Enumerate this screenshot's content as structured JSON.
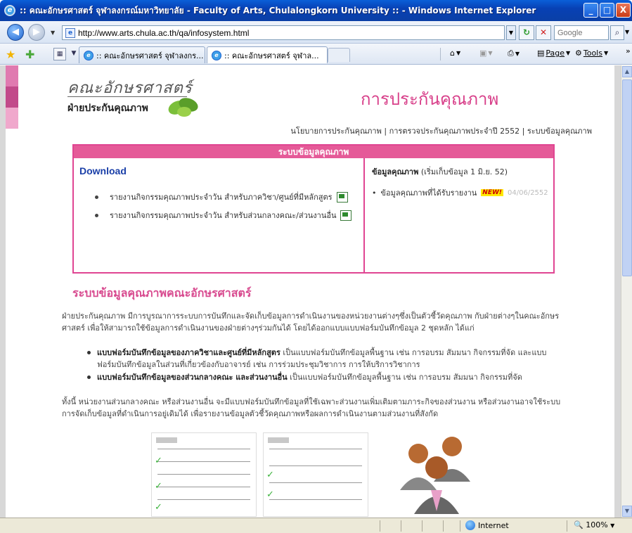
{
  "window": {
    "title": ":: คณะอักษรศาสตร์ จุฬาลงกรณ์มหาวิทยาลัย - Faculty of Arts, Chulalongkorn University :: - Windows Internet Explorer",
    "minimize": "_",
    "maximize": "□",
    "close": "X"
  },
  "addressbar": {
    "url": "http://www.arts.chula.ac.th/qa/infosystem.html",
    "search_placeholder": "Google"
  },
  "tabs": [
    {
      "label": ":: คณะอักษรศาสตร์ จุฬาลงกร..."
    },
    {
      "label": ":: คณะอักษรศาสตร์ จุฬาล...",
      "close": "X"
    }
  ],
  "commandbar": {
    "page": "Page",
    "tools": "Tools",
    "more": "»"
  },
  "site": {
    "logo_line1": "คณะอักษรศาสตร์",
    "logo_line2": "ฝ่ายประกันคุณภาพ",
    "page_heading": "การประกันคุณภาพ",
    "topnav": [
      "นโยบายการประกันคุณภาพ",
      "การตรวจประกันคุณภาพประจำปี 2552",
      "ระบบข้อมูลคุณภาพ"
    ],
    "topnav_separator": "|"
  },
  "infobox": {
    "header": "ระบบข้อมูลคุณภาพ",
    "download_title": "Download",
    "download_items": [
      "รายงานกิจกรรมคุณภาพประจำวัน สำหรับภาควิชา/ศูนย์ที่มีหลักสูตร",
      "รายงานกิจกรรมคุณภาพประจำวัน สำหรับส่วนกลางคณะ/ส่วนงานอื่น"
    ],
    "right_title_bold": "ข้อมูลคุณภาพ",
    "right_title_note": "(เริ่มเก็บข้อมูล 1 มิ.ย. 52)",
    "right_item": "ข้อมูลคุณภาพที่ได้รับรายงาน",
    "new_badge": "NEW!",
    "right_item_date": "04/06/2552"
  },
  "section": {
    "title": "ระบบข้อมูลคุณภาพคณะอักษรศาสตร์",
    "para1": "ฝ่ายประกันคุณภาพ มีการบูรณาการระบบการบันทึกและจัดเก็บข้อมูลการดำเนินงานของหน่วยงานต่างๆซึ่งเป็นตัวชี้วัดคุณภาพ กับฝ่ายต่างๆในคณะอักษรศาสตร์ เพื่อให้สามารถใช้ข้อมูลการดำเนินงานของฝ่ายต่างๆร่วมกันได้ โดยได้ออกแบบแบบฟอร์มบันทึกข้อมูล 2 ชุดหลัก ได้แก่",
    "bullet1_bold": "แบบฟอร์มบันทึกข้อมูลของภาควิชาและศูนย์ที่มีหลักสูตร",
    "bullet1_text": " เป็นแบบฟอร์มบันทึกข้อมูลพื้นฐาน เช่น การอบรม สัมมนา กิจกรรมที่จัด และแบบฟอร์มบันทึกข้อมูลในส่วนที่เกี่ยวข้องกับอาจารย์ เช่น การร่วมประชุมวิชาการ การให้บริการวิชาการ",
    "bullet2_bold": "แบบฟอร์มบันทึกข้อมูลของส่วนกลางคณะ และส่วนงานอื่น",
    "bullet2_text": " เป็นแบบฟอร์มบันทึกข้อมูลพื้นฐาน เช่น การอบรม สัมมนา กิจกรรมที่จัด",
    "para2": "ทั้งนี้ หน่วยงานส่วนกลางคณะ หรือส่วนงานอื่น จะมีแบบฟอร์มบันทึกข้อมูลที่ใช้เฉพาะส่วนงานเพิ่มเติมตามภาระกิจของส่วนงาน หรือส่วนงานอาจใช้ระบบการจัดเก็บข้อมูลที่ดำเนินการอยู่เดิมได้ เพื่อรายงานข้อมูลตัวชี้วัดคุณภาพหรือผลการดำเนินงานตามส่วนงานที่สังกัด"
  },
  "statusbar": {
    "zone": "Internet",
    "zoom": "100%"
  },
  "colors": {
    "pink_accent": "#e04592",
    "heading_pink": "#d84a8f",
    "download_blue": "#1a3fa8",
    "titlebar_blue": "#0841b4"
  }
}
